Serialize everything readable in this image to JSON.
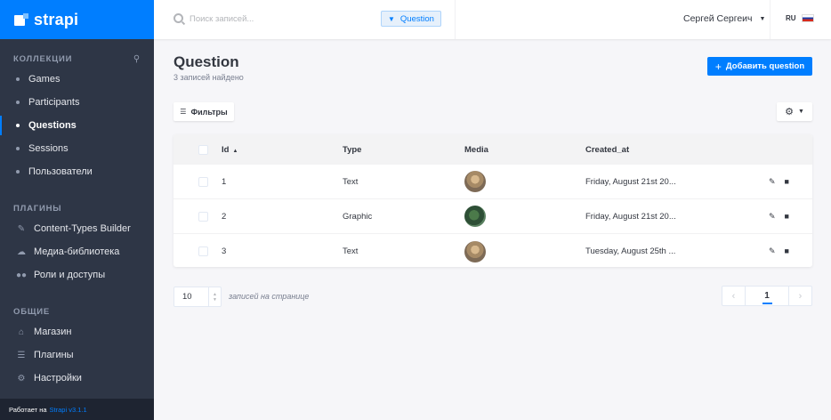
{
  "brand": {
    "name": "strapi"
  },
  "sidebar": {
    "collections_title": "КОЛЛЕКЦИИ",
    "collections": [
      {
        "label": "Games"
      },
      {
        "label": "Participants"
      },
      {
        "label": "Questions",
        "active": true
      },
      {
        "label": "Sessions"
      },
      {
        "label": "Пользователи"
      }
    ],
    "plugins_title": "ПЛАГИНЫ",
    "plugins": [
      {
        "label": "Content-Types Builder",
        "icon": "brush-icon"
      },
      {
        "label": "Медиа-библиотека",
        "icon": "cloud-icon"
      },
      {
        "label": "Роли и доступы",
        "icon": "users-icon"
      }
    ],
    "general_title": "ОБЩИЕ",
    "general": [
      {
        "label": "Магазин",
        "icon": "store-icon"
      },
      {
        "label": "Плагины",
        "icon": "list-icon"
      },
      {
        "label": "Настройки",
        "icon": "gear-icon"
      }
    ],
    "powered_prefix": "Работает на",
    "powered_link": "Strapi v3.1.1"
  },
  "header": {
    "search_placeholder": "Поиск записей...",
    "search_value": "",
    "filter_tag": "Question",
    "user_name": "Сергей Сергеич",
    "lang": "RU"
  },
  "main": {
    "title": "Question",
    "subtitle": "3 записей найдено",
    "add_button": "Добавить question",
    "filters_button": "Фильтры",
    "columns": {
      "id": "Id",
      "type": "Type",
      "media": "Media",
      "created_at": "Created_at"
    },
    "rows": [
      {
        "id": "1",
        "type": "Text",
        "created_at": "Friday, August 21st 20..."
      },
      {
        "id": "2",
        "type": "Graphic",
        "created_at": "Friday, August 21st 20..."
      },
      {
        "id": "3",
        "type": "Text",
        "created_at": "Tuesday, August 25th ..."
      }
    ],
    "per_page_value": "10",
    "per_page_label": "записей на странице",
    "current_page": "1"
  },
  "colors": {
    "accent": "#007eff",
    "sidebar_bg": "#2e3646",
    "page_bg": "#f6f6f9"
  }
}
